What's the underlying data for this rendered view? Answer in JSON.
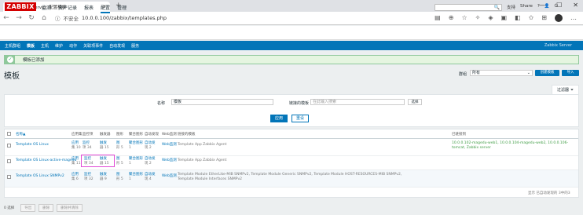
{
  "browser": {
    "tab_title": "Zabbix Server: 配置模板",
    "url_prefix": "不安全",
    "url": "10.0.0.100/zabbix/templates.php"
  },
  "app": {
    "logo": "ZABBIX",
    "menu": [
      "监测",
      "资产记录",
      "报表",
      "配置",
      "管理"
    ],
    "active_menu": "配置",
    "user_links": [
      "支持",
      "Share",
      "?",
      "👤",
      "⏻"
    ],
    "subnav": [
      "主机群组",
      "模板",
      "主机",
      "维护",
      "动作",
      "关联项事件",
      "自动发现",
      "服务"
    ],
    "active_subnav": "模板",
    "brand_right": "Zabbix Server"
  },
  "message": {
    "text": "模板已添加"
  },
  "page": {
    "title": "模板",
    "group_label": "群组",
    "group_value": "所有",
    "create_button": "创建模板",
    "import_button": "导入",
    "filter_tab": "过滤器"
  },
  "filter": {
    "name_label": "名称",
    "name_value": "模板",
    "linked_label": "链接的模板",
    "linked_placeholder": "在此输入搜索",
    "select_button": "选择",
    "apply": "应用",
    "reset": "重设"
  },
  "table": {
    "headers": [
      "名称▲",
      "应用集",
      "监控项",
      "触发器",
      "图形",
      "聚合图形",
      "自动发现",
      "Web监测",
      "链接的模板",
      "已链接到"
    ],
    "rows": [
      {
        "name": "Template OS Linux",
        "apps": "应用",
        "apps_n": "集 10",
        "items": "监控",
        "items_n": "项 34",
        "triggers": "触发",
        "triggers_n": "器 15",
        "graphs": "图",
        "graphs_n": "形 5",
        "screens": "聚合图形",
        "screens_n": "1",
        "discovery": "自动发",
        "discovery_n": "现 2",
        "web": "Web监测",
        "linked": "Template App Zabbix Agent",
        "linked_to": "10.0.0.102-magedu-web1, 10.0.0.104-magedu-web2, 10.0.0.106-tomcat, Zabbix server"
      },
      {
        "name": "Template OS Linux-active-magedu",
        "apps": "应用",
        "apps_n": "集 11",
        "items": "监控",
        "items_n": "项 34",
        "triggers": "触发",
        "triggers_n": "器 15",
        "graphs": "图",
        "graphs_n": "形 5",
        "screens": "聚合图形",
        "screens_n": "1",
        "discovery": "自动发",
        "discovery_n": "现 2",
        "web": "Web监测",
        "linked": "Template App Zabbix Agent",
        "linked_to": ""
      },
      {
        "name": "Template OS Linux SNMPv2",
        "apps": "应用",
        "apps_n": "集 6",
        "items": "监控",
        "items_n": "项 32",
        "triggers": "触发",
        "triggers_n": "器 9",
        "graphs": "图",
        "graphs_n": "形 5",
        "screens": "聚合图形",
        "screens_n": "1",
        "discovery": "自动发",
        "discovery_n": "现 4",
        "web": "Web监测",
        "linked": "Template Module EtherLike-MIB SNMPv2, Template Module Generic SNMPv2, Template Module HOST-RESOURCES-MIB SNMPv2,",
        "linked2": "Template Module Interfaces SNMPv2",
        "linked_to": ""
      }
    ],
    "footer": "显示 已自动发现的 3中的3"
  },
  "bottom": {
    "selected": "0 选择",
    "buttons": [
      "导出",
      "删除",
      "删除并清除"
    ]
  }
}
